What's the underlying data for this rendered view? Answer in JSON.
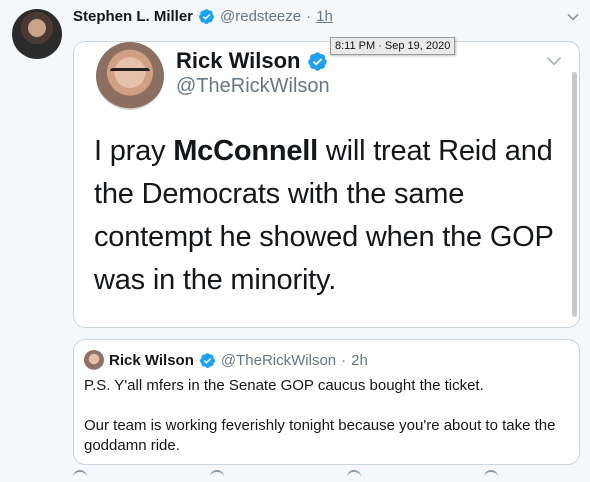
{
  "tweet": {
    "author_name": "Stephen L. Miller",
    "author_handle": "@redsteeze",
    "separator": "·",
    "time": "1h",
    "tooltip": "8:11 PM · Sep 19, 2020",
    "avatar_icon": "user-avatar"
  },
  "embedded_screenshot": {
    "author_name": "Rick Wilson",
    "author_handle": "@TheRickWilson",
    "text_before": "I pray ",
    "text_bold": "McConnell",
    "text_after": " will treat Reid and the Democrats with the same contempt he showed when the GOP was in the minority."
  },
  "quoted_tweet": {
    "author_name": "Rick Wilson",
    "author_handle": "@TheRickWilson",
    "separator": "·",
    "time": "2h",
    "paragraphs": [
      "P.S. Y'all mfers in the Senate GOP caucus bought the ticket.",
      "Our team is working feverishly tonight because you're about to take the goddamn ride."
    ]
  },
  "colors": {
    "verified": "#1da1f2",
    "secondary_text": "#657786",
    "border": "#ccd6dd",
    "background": "#f5f8fa"
  },
  "icons": [
    "verified-badge-icon",
    "chevron-down-icon",
    "reply-icon",
    "retweet-icon",
    "like-icon",
    "share-icon"
  ]
}
